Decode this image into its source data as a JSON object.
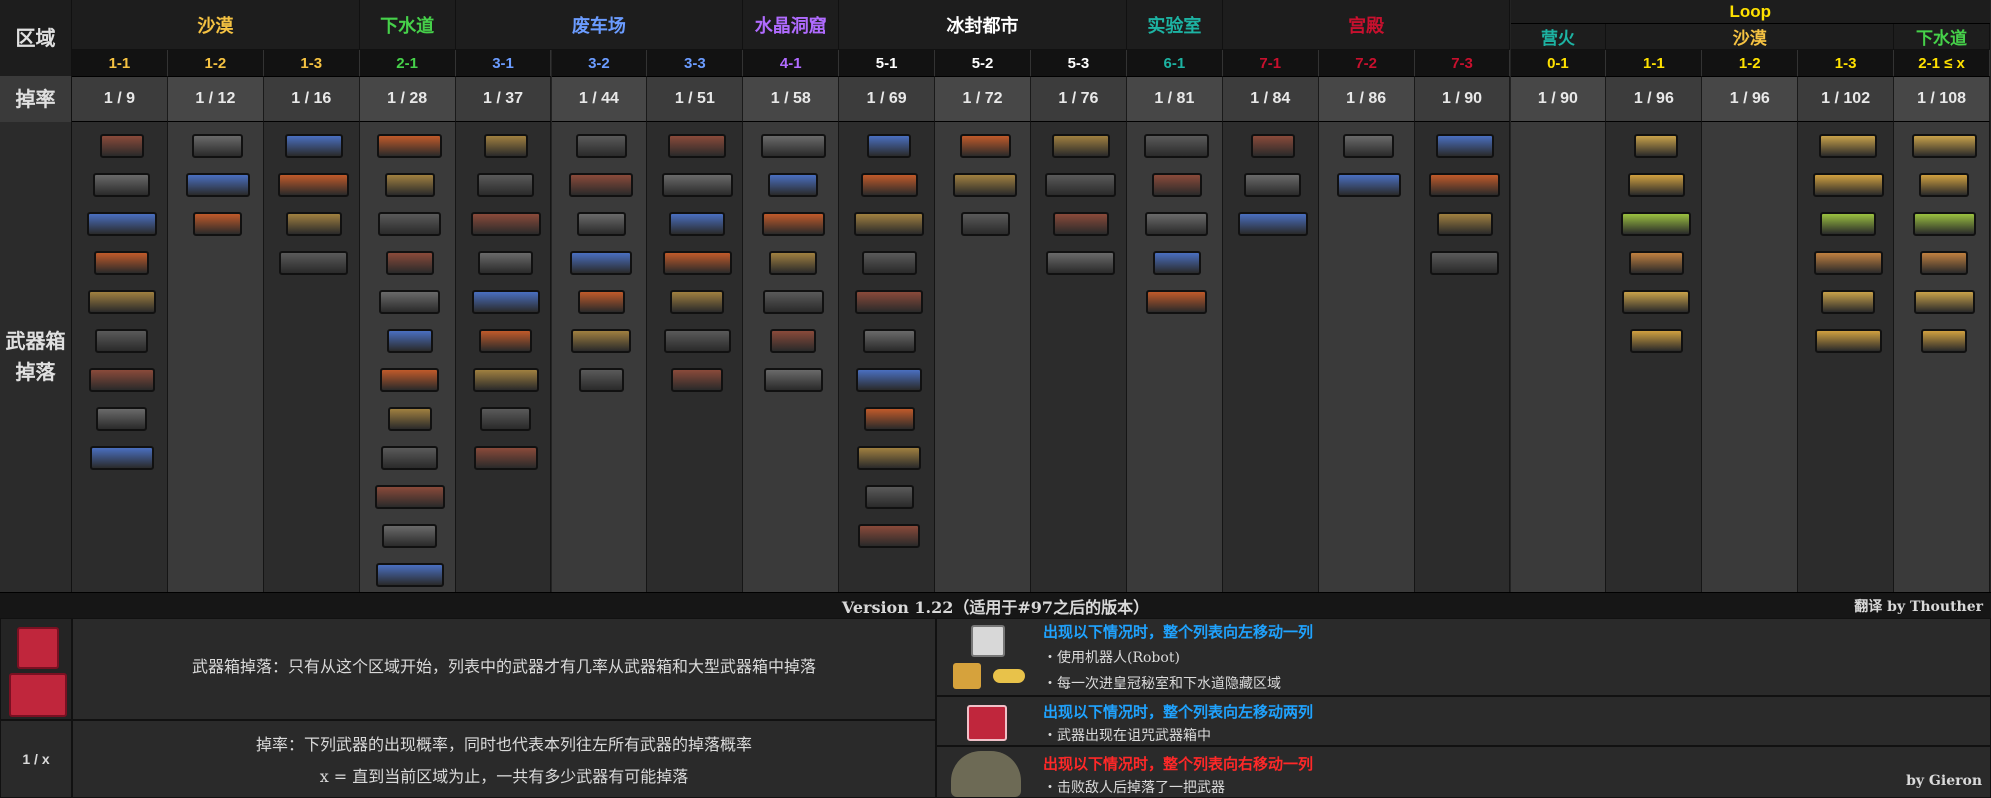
{
  "colors": {
    "desert": "#f5c242",
    "sewer": "#46d14a",
    "scrap": "#6b9cff",
    "crystal": "#b06bff",
    "frozen": "#ffffff",
    "labs": "#1db3a3",
    "palace": "#c8102e",
    "stage_yellow": "#ffe100",
    "campfire": "#1db3a3"
  },
  "left": {
    "zone_label": "区域",
    "rate_label": "掉率",
    "drop_label": "武器箱掉落"
  },
  "zones": [
    {
      "name": "沙漠",
      "color": "#f5c242"
    },
    {
      "name": "下水道",
      "color": "#46d14a"
    },
    {
      "name": "废车场",
      "color": "#6b9cff"
    },
    {
      "name": "水晶洞窟",
      "color": "#b06bff"
    },
    {
      "name": "冰封都市",
      "color": "#ffffff"
    },
    {
      "name": "实验室",
      "color": "#1db3a3"
    },
    {
      "name": "宫殿",
      "color": "#c8102e"
    }
  ],
  "loop": {
    "title": "Loop",
    "zones": [
      {
        "name": "营火",
        "color": "#1db3a3"
      },
      {
        "name": "沙漠",
        "color": "#f5c242"
      },
      {
        "name": "下水道",
        "color": "#46d14a"
      }
    ]
  },
  "columns": [
    {
      "stage": "1-1",
      "stage_color": "#f5c242",
      "rate": "1 / 9",
      "icons": [
        "pistol-icon",
        "assault-rifle-icon",
        "shotgun-icon",
        "sawed-off-icon",
        "crossbow-icon",
        "revolver-icon",
        "machinegun-icon",
        "wrench-icon",
        "laser-pistol-icon"
      ]
    },
    {
      "stage": "1-2",
      "stage_color": "#f5c242",
      "rate": "1 / 12",
      "icons": [
        "smg-icon",
        "double-shotgun-icon",
        "grenade-icon"
      ]
    },
    {
      "stage": "1-3",
      "stage_color": "#f5c242",
      "rate": "1 / 16",
      "icons": [
        "grenade-launcher-icon",
        "shovel-icon",
        "sledgehammer-icon",
        "hammer-icon"
      ]
    },
    {
      "stage": "2-1",
      "stage_color": "#46d14a",
      "rate": "1 / 28",
      "icons": [
        "flare-gun-icon",
        "long-shotgun-icon",
        "pop-gun-icon",
        "toxic-launcher-icon",
        "disc-gun-icon",
        "bouncer-icon",
        "plasma-gun-icon",
        "heavy-launcher-icon",
        "rocket-launcher-icon",
        "lightning-rifle-icon",
        "blaster-icon",
        "golden-pistol-icon"
      ]
    },
    {
      "stage": "3-1",
      "stage_color": "#6b9cff",
      "rate": "1 / 37",
      "icons": [
        "minigun-icon",
        "auto-shotgun-icon",
        "splinter-gun-icon",
        "wave-gun-icon",
        "sniper-rifle-icon",
        "heavy-revolver-icon",
        "screwdriver-icon",
        "blood-hammer-icon",
        "laser-rifle-icon"
      ]
    },
    {
      "stage": "3-2",
      "stage_color": "#6b9cff",
      "rate": "1 / 44",
      "icons": [
        "flamethrower-icon",
        "energy-sword-icon",
        "ion-cannon-icon",
        "toxic-bow-icon",
        "heavy-crossbow-icon",
        "bazooka-icon",
        "plasma-cannon-icon"
      ]
    },
    {
      "stage": "3-3",
      "stage_color": "#6b9cff",
      "rate": "1 / 51",
      "icons": [
        "lightning-cannon-icon",
        "seeker-pistol-icon",
        "heavy-crossbow-icon",
        "disperse-gun-icon",
        "jackhammer-icon",
        "ultra-shovel-icon",
        "laser-cannon-icon"
      ]
    },
    {
      "stage": "4-1",
      "stage_color": "#b06bff",
      "rate": "1 / 58",
      "icons": [
        "gatling-icon",
        "crystal-pistol-icon",
        "super-crossbow-icon",
        "flak-cannon-icon",
        "ultra-laser-icon",
        "plasma-minigun-icon",
        "green-laser-icon"
      ]
    },
    {
      "stage": "5-1",
      "stage_color": "#ffffff",
      "rate": "1 / 69",
      "icons": [
        "devastator-icon",
        "hyper-rifle-icon",
        "super-flak-icon",
        "auto-crossbow-icon",
        "lightning-smg-icon",
        "flame-pistol-icon",
        "heavy-grenade-icon",
        "blood-launcher-icon",
        "blood-cannon-icon",
        "energy-hammer-icon",
        "energy-screwdriver-icon"
      ]
    },
    {
      "stage": "5-2",
      "stage_color": "#ffffff",
      "rate": "1 / 72",
      "icons": [
        "super-plasma-cannon-icon",
        "ultra-revolver-icon",
        "lightning-hammer-icon"
      ]
    },
    {
      "stage": "5-3",
      "stage_color": "#ffffff",
      "rate": "1 / 76",
      "icons": [
        "mini-plasma-icon",
        "sticky-launcher-icon",
        "hyper-launcher-icon",
        "blood-hammer-icon"
      ]
    },
    {
      "stage": "6-1",
      "stage_color": "#1db3a3",
      "rate": "1 / 81",
      "icons": [
        "rogue-rifle-icon",
        "hyper-slugger-icon",
        "ultra-shotgun-icon",
        "pulse-rifle-icon",
        "plasma-rifle-icon"
      ]
    },
    {
      "stage": "7-1",
      "stage_color": "#c8102e",
      "rate": "1 / 84",
      "icons": [
        "gatling-bazooka-icon",
        "frog-pistol-icon",
        "heavy-slugger-icon"
      ]
    },
    {
      "stage": "7-2",
      "stage_color": "#c8102e",
      "rate": "1 / 86",
      "icons": [
        "ultra-crossbow-icon",
        "lightning-minigun-icon"
      ]
    },
    {
      "stage": "7-3",
      "stage_color": "#c8102e",
      "rate": "1 / 90",
      "icons": [
        "ultra-flamethrower-icon",
        "ultra-laser-pistol-icon",
        "ultra-lightning-icon",
        "ultra-crystal-icon"
      ]
    },
    {
      "stage": "0-1",
      "stage_color": "#ffe100",
      "rate": "1 / 90",
      "icons": []
    },
    {
      "stage": "1-1",
      "stage_color": "#ffe100",
      "rate": "1 / 96",
      "icons": [
        "gold-pistol-icon",
        "gold-shotgun-icon",
        "gold-flare-icon",
        "gold-smg-icon",
        "gold-wrench-icon",
        "gold-laser-icon"
      ]
    },
    {
      "stage": "1-2",
      "stage_color": "#ffe100",
      "rate": "1 / 96",
      "icons": []
    },
    {
      "stage": "1-3",
      "stage_color": "#ffe100",
      "rate": "1 / 102",
      "icons": [
        "gold-revolver-icon",
        "gold-crossbow-icon",
        "gold-grenade-icon",
        "gold-rocket-icon",
        "gold-disc-icon",
        "gold-bolt-icon"
      ]
    },
    {
      "stage": "2-1 ≤ x",
      "stage_color": "#ffe100",
      "rate": "1 / 108",
      "icons": [
        "green-pistol-icon",
        "toxic-gun-icon",
        "green-arrow-icon",
        "green-launcher-icon",
        "green-smg-icon",
        "super-hammer-icon"
      ]
    }
  ],
  "version": "Version 1.22（适用于#97之后的版本）",
  "translator": "翻译 by Thouther",
  "author": "by Gieron",
  "legend": {
    "chest_text": "武器箱掉落：只有从这个区域开始，列表中的武器才有几率从武器箱和大型武器箱中掉落",
    "rate_key": "1 / x",
    "rate_line1": "掉率：下列武器的出现概率，同时也代表本列往左所有武器的掉落概率",
    "rate_line2": "x = 直到当前区域为止，一共有多少武器有可能掉落",
    "shift1_title": "出现以下情况时，整个列表向左移动一列",
    "shift1_a": "・使用机器人(Robot)",
    "shift1_b": "・每一次进皇冠秘室和下水道隐藏区域",
    "shift2_title": "出现以下情况时，整个列表向左移动两列",
    "shift2_a": "・武器出现在诅咒武器箱中",
    "shift3_title": "出现以下情况时，整个列表向右移动一列",
    "shift3_a": "・击败敌人后掉落了一把武器"
  }
}
